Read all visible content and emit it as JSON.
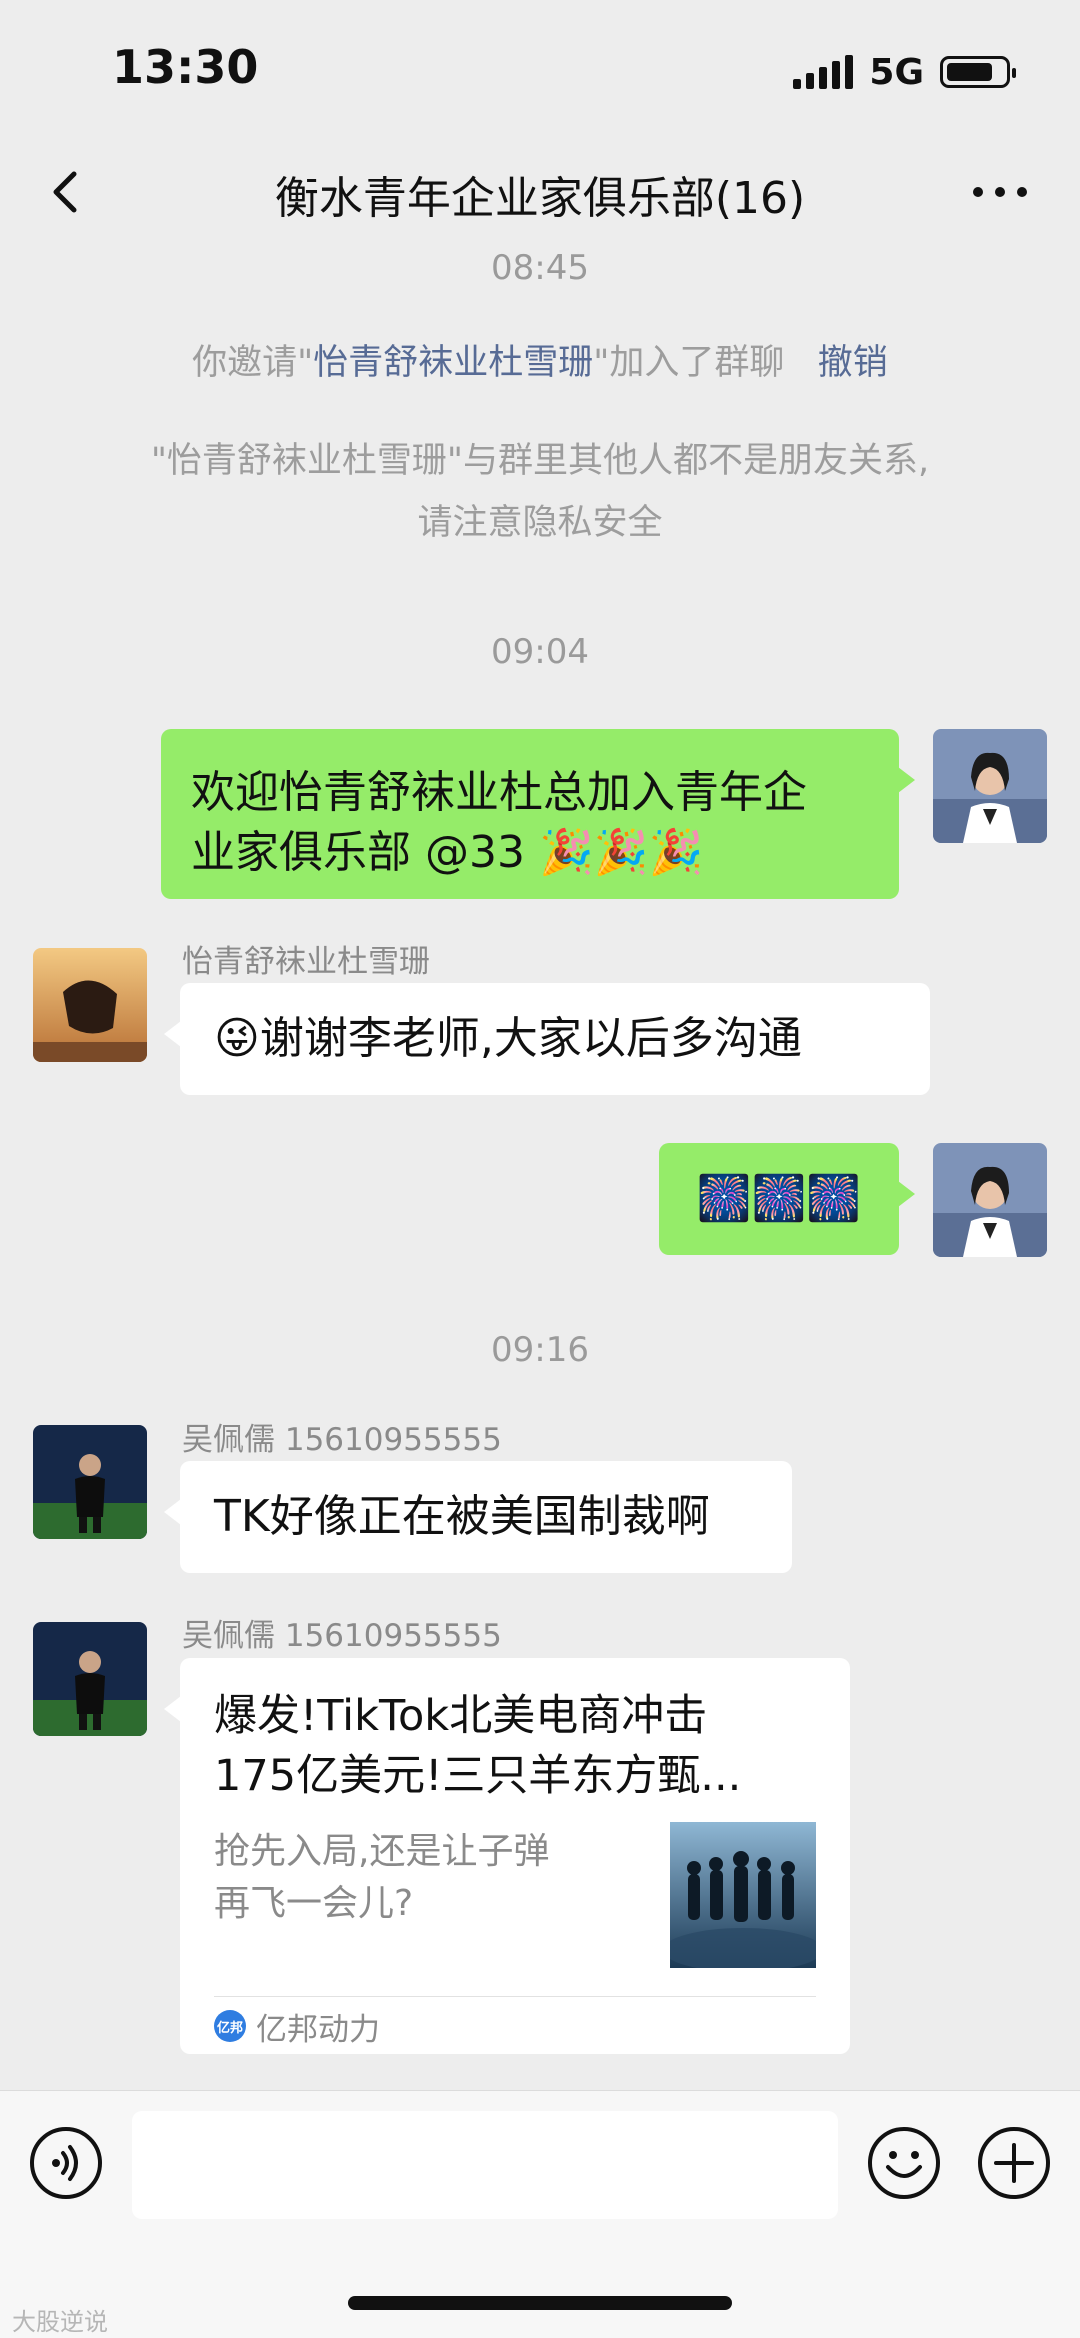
{
  "status_bar": {
    "time": "13:30",
    "network": "5G",
    "battery_level": 0.8
  },
  "nav": {
    "title": "衡水青年企业家俱乐部(16)",
    "back_icon": "chevron-left-icon",
    "more_icon": "ellipsis-icon"
  },
  "messages": {
    "t1": "08:45",
    "invite_prefix": "你邀请\"",
    "invite_name": "怡青舒袜业杜雪珊",
    "invite_suffix": "\"加入了群聊",
    "invite_undo": "撤销",
    "privacy_line1": "\"怡青舒袜业杜雪珊\"与群里其他人都不是朋友关系,",
    "privacy_line2": "请注意隐私安全",
    "t2": "09:04",
    "me1_line1": "欢迎怡青舒袜业杜总加入青年企",
    "me1_line2": "业家俱乐部 @33 🎉🎉🎉",
    "sender1": "怡青舒袜业杜雪珊",
    "other1": "😜谢谢李老师,大家以后多沟通",
    "me2": "🎆🎆🎆",
    "t3": "09:16",
    "sender2": "吴佩儒 15610955555",
    "other2": "TK好像正在被美国制裁啊",
    "sender3": "吴佩儒 15610955555"
  },
  "card": {
    "title_line1": "爆发!TikTok北美电商冲击",
    "title_line2": "175亿美元!三只羊东方甄...",
    "desc_line1": "抢先入局,还是让子弹",
    "desc_line2": "再飞一会儿?",
    "source": "亿邦动力",
    "source_logo_text": "亿邦"
  },
  "input": {
    "placeholder": ""
  },
  "watermark": "大股逆说",
  "colors": {
    "my_bubble": "#95ec69",
    "link": "#576b95",
    "background": "#ededed"
  }
}
